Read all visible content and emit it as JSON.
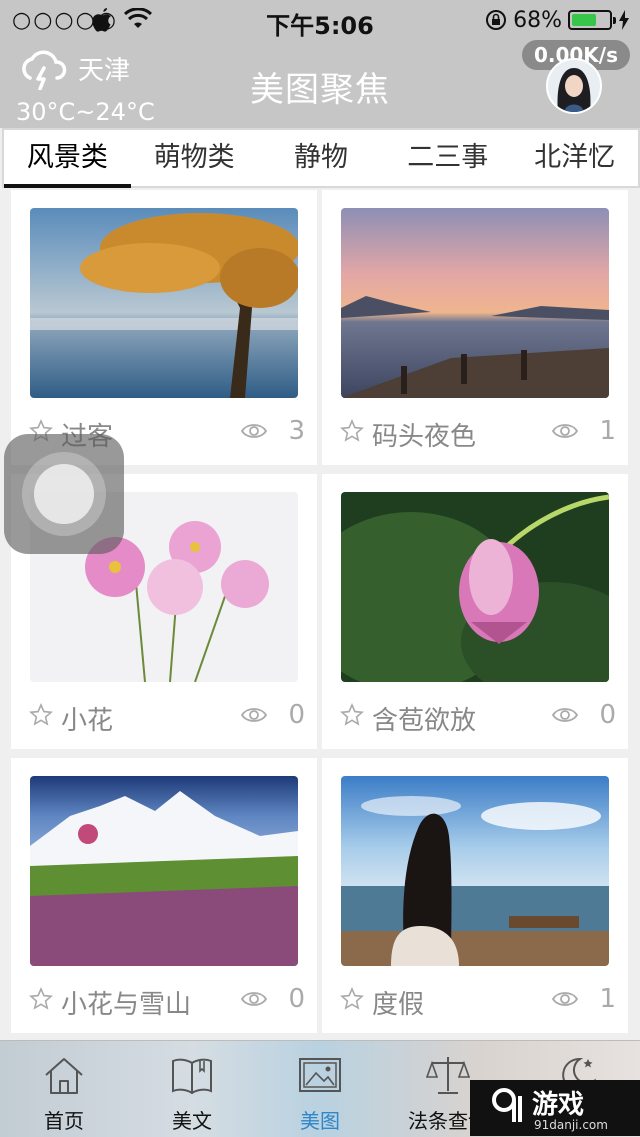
{
  "status": {
    "signal": "○○○○○",
    "time": "下午5:06",
    "battery": "68%",
    "battery_level": 0.68
  },
  "header": {
    "city": "天津",
    "temp": "30°C~24°C",
    "title": "美图聚焦",
    "speed": "0.00K/s"
  },
  "tabs": [
    "风景类",
    "萌物类",
    "静物",
    "二三事",
    "北洋忆"
  ],
  "cards": [
    {
      "name": "过客",
      "views": "3"
    },
    {
      "name": "码头夜色",
      "views": "1"
    },
    {
      "name": "小花",
      "views": "0"
    },
    {
      "name": "含苞欲放",
      "views": "0"
    },
    {
      "name": "小花与雪山",
      "views": "0"
    },
    {
      "name": "度假",
      "views": "1"
    }
  ],
  "tabbar": [
    "首页",
    "美文",
    "美图",
    "法条查询",
    "夜读"
  ],
  "watermark": {
    "text": "游戏",
    "site": "91danji.com"
  },
  "colors": {
    "active_tab": "#2f86c8",
    "header_bg": "#c6c6c6"
  }
}
